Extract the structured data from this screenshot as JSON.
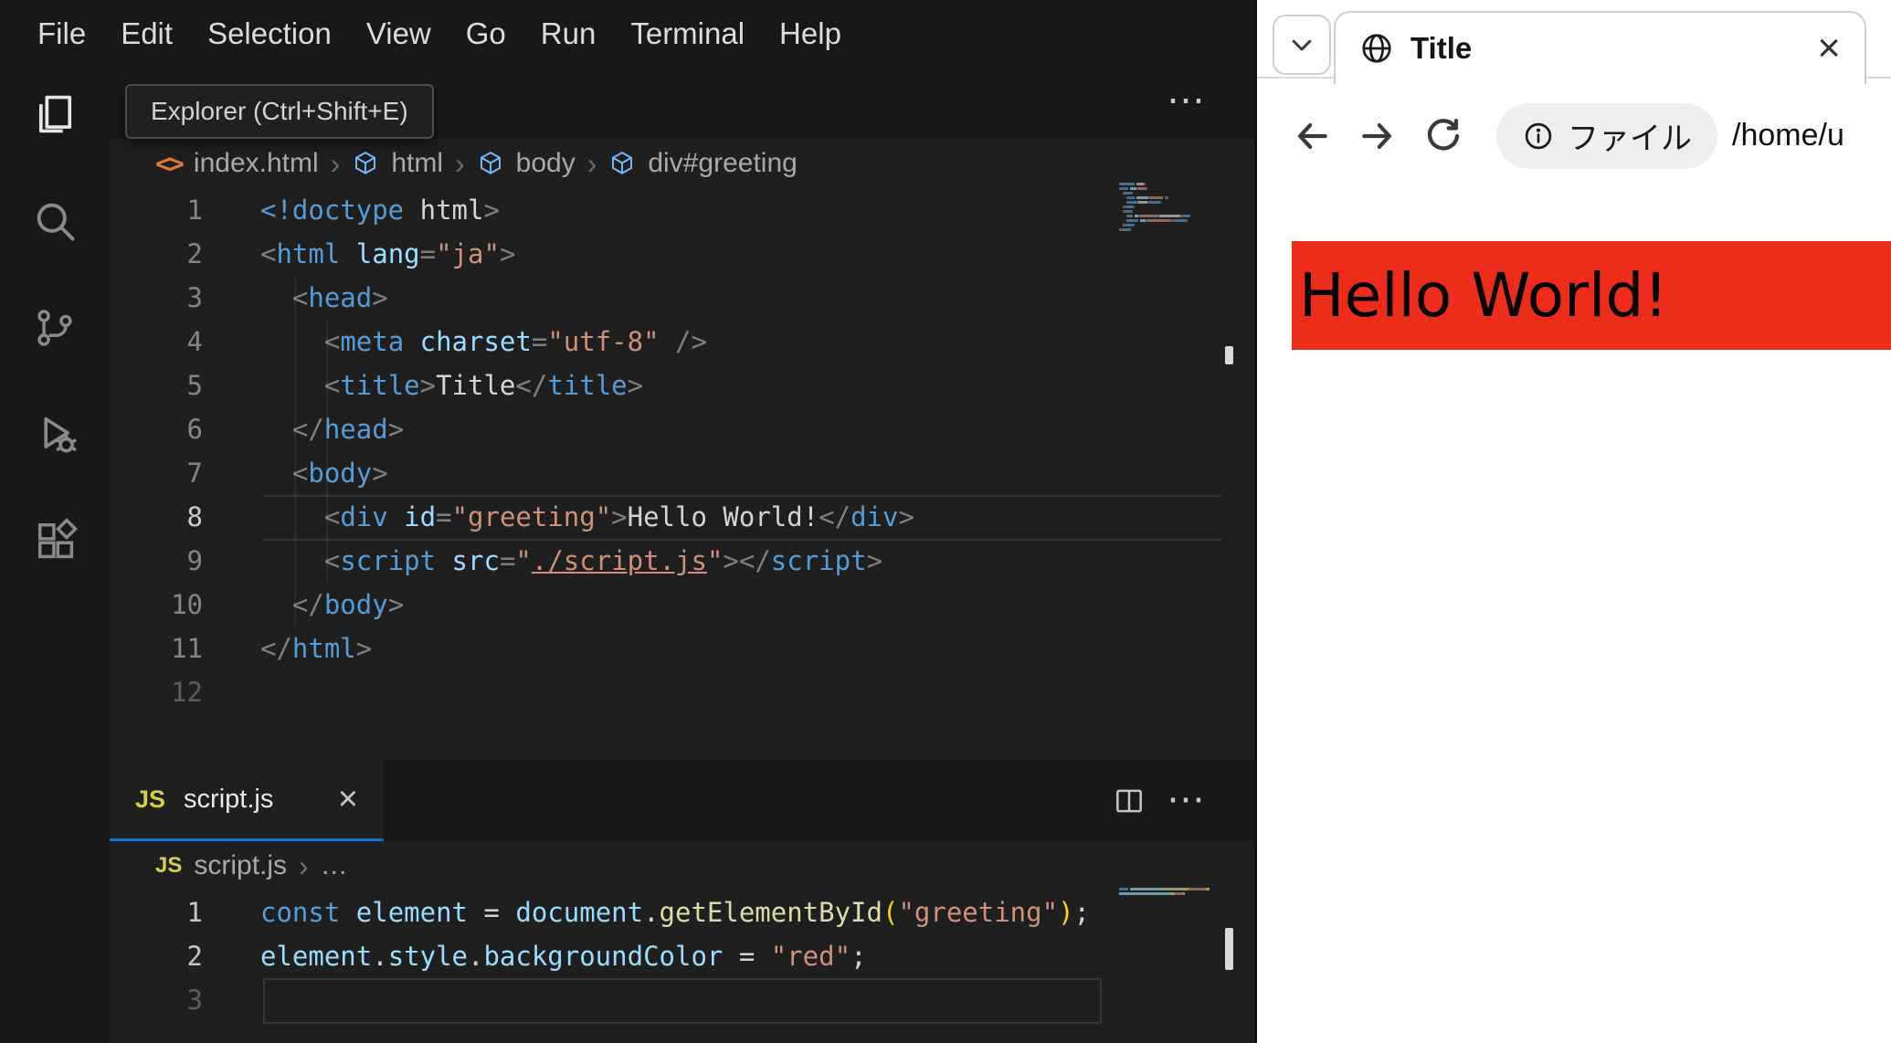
{
  "vscode": {
    "menubar": {
      "items": [
        "File",
        "Edit",
        "Selection",
        "View",
        "Go",
        "Run",
        "Terminal",
        "Help"
      ]
    },
    "activity_bar": {
      "items": [
        "explorer",
        "search",
        "source-control",
        "run-and-debug",
        "extensions"
      ]
    },
    "tooltip": {
      "text": "Explorer (Ctrl+Shift+E)"
    },
    "editor_actions": {
      "more": "⋯"
    },
    "top_editor": {
      "breadcrumb": {
        "file_icon": "<>",
        "file_label": "index.html",
        "separator": "›",
        "symbols": [
          "html",
          "body",
          "div#greeting"
        ]
      },
      "active_line": 8,
      "code_lines": [
        {
          "n": "1",
          "s": [
            [
              "<!doctype",
              "tag"
            ],
            [
              " ",
              "fg"
            ],
            [
              "html",
              "fg"
            ],
            [
              ">",
              "punc"
            ]
          ]
        },
        {
          "n": "2",
          "s": [
            [
              "<",
              "punc"
            ],
            [
              "html",
              "tag"
            ],
            [
              " ",
              "fg"
            ],
            [
              "lang",
              "attr"
            ],
            [
              "=",
              "punc"
            ],
            [
              "\"ja\"",
              "str"
            ],
            [
              ">",
              "punc"
            ]
          ]
        },
        {
          "n": "3",
          "s": [
            [
              "  ",
              "fg"
            ],
            [
              "<",
              "punc"
            ],
            [
              "head",
              "tag"
            ],
            [
              ">",
              "punc"
            ]
          ]
        },
        {
          "n": "4",
          "s": [
            [
              "    ",
              "fg"
            ],
            [
              "<",
              "punc"
            ],
            [
              "meta",
              "tag"
            ],
            [
              " ",
              "fg"
            ],
            [
              "charset",
              "attr"
            ],
            [
              "=",
              "punc"
            ],
            [
              "\"utf-8\"",
              "str"
            ],
            [
              " ",
              "fg"
            ],
            [
              "/>",
              "punc"
            ]
          ]
        },
        {
          "n": "5",
          "s": [
            [
              "    ",
              "fg"
            ],
            [
              "<",
              "punc"
            ],
            [
              "title",
              "tag"
            ],
            [
              ">",
              "punc"
            ],
            [
              "Title",
              "fg"
            ],
            [
              "</",
              "punc"
            ],
            [
              "title",
              "tag"
            ],
            [
              ">",
              "punc"
            ]
          ]
        },
        {
          "n": "6",
          "s": [
            [
              "  ",
              "fg"
            ],
            [
              "</",
              "punc"
            ],
            [
              "head",
              "tag"
            ],
            [
              ">",
              "punc"
            ]
          ]
        },
        {
          "n": "7",
          "s": [
            [
              "  ",
              "fg"
            ],
            [
              "<",
              "punc"
            ],
            [
              "body",
              "tag"
            ],
            [
              ">",
              "punc"
            ]
          ]
        },
        {
          "n": "8",
          "lnc": "lineno_active",
          "s": [
            [
              "    ",
              "fg"
            ],
            [
              "<",
              "punc"
            ],
            [
              "div",
              "tag"
            ],
            [
              " ",
              "fg"
            ],
            [
              "id",
              "attr"
            ],
            [
              "=",
              "punc"
            ],
            [
              "\"greeting\"",
              "str"
            ],
            [
              ">",
              "punc"
            ],
            [
              "Hello World!",
              "fg"
            ],
            [
              "</",
              "punc"
            ],
            [
              "div",
              "tag"
            ],
            [
              ">",
              "punc"
            ]
          ]
        },
        {
          "n": "9",
          "s": [
            [
              "    ",
              "fg"
            ],
            [
              "<",
              "punc"
            ],
            [
              "script",
              "tag"
            ],
            [
              " ",
              "fg"
            ],
            [
              "src",
              "attr"
            ],
            [
              "=",
              "punc"
            ],
            [
              "\"",
              "str"
            ],
            [
              "./script.js",
              "link"
            ],
            [
              "\"",
              "str"
            ],
            [
              ">",
              "punc"
            ],
            [
              "</",
              "punc"
            ],
            [
              "script",
              "tag"
            ],
            [
              ">",
              "punc"
            ]
          ]
        },
        {
          "n": "10",
          "s": [
            [
              "  ",
              "fg"
            ],
            [
              "</",
              "punc"
            ],
            [
              "body",
              "tag"
            ],
            [
              ">",
              "punc"
            ]
          ]
        },
        {
          "n": "11",
          "s": [
            [
              "</",
              "punc"
            ],
            [
              "html",
              "tag"
            ],
            [
              ">",
              "punc"
            ]
          ]
        },
        {
          "n": "12",
          "lnc": "lineno_dim",
          "s": []
        }
      ]
    },
    "panel": {
      "tab": {
        "icon_text": "JS",
        "label": "script.js",
        "close_label": "×"
      },
      "breadcrumb": {
        "icon_text": "JS",
        "file_label": "script.js",
        "separator": "›",
        "more": "…"
      },
      "active_line": 3,
      "code_lines": [
        {
          "n": "1",
          "lnc": "lineno_bright",
          "s": [
            [
              "const",
              "kw"
            ],
            [
              " ",
              "fg"
            ],
            [
              "element",
              "attr"
            ],
            [
              " = ",
              "fg"
            ],
            [
              "document",
              "attr"
            ],
            [
              ".",
              "fg"
            ],
            [
              "getElementById",
              "func"
            ],
            [
              "(",
              "bracket"
            ],
            [
              "\"greeting\"",
              "str"
            ],
            [
              ")",
              "bracket"
            ],
            [
              ";",
              "fg"
            ]
          ]
        },
        {
          "n": "2",
          "lnc": "lineno_bright",
          "s": [
            [
              "element",
              "attr"
            ],
            [
              ".",
              "fg"
            ],
            [
              "style",
              "attr"
            ],
            [
              ".",
              "fg"
            ],
            [
              "backgroundColor",
              "attr"
            ],
            [
              " = ",
              "fg"
            ],
            [
              "\"red\"",
              "str"
            ],
            [
              ";",
              "fg"
            ]
          ]
        },
        {
          "n": "3",
          "lnc": "lineno_dim",
          "s": []
        }
      ]
    },
    "syntax_colors": {
      "fg": "#d4d4d4",
      "tag": "#569cd6",
      "attr": "#9cdcfe",
      "str": "#ce9178",
      "punc": "#808080",
      "kw": "#569cd6",
      "func": "#dcdcaa",
      "bracket": "#ffd700",
      "link": "#ce9178",
      "lineno": "#858585",
      "lineno_active": "#cccccc",
      "lineno_bright": "#c6c6c6",
      "lineno_dim": "#5c5c5c",
      "accent": "#0078d4",
      "js_icon": "#d7cf42",
      "html_icon": "#e37933",
      "symbol_icon": "#75beff"
    }
  },
  "browser": {
    "tab": {
      "title": "Title",
      "close_label": "×"
    },
    "toolbar": {
      "chip_label": "ファイル",
      "url_text": "/home/u"
    },
    "page": {
      "heading": "Hello World!",
      "heading_bg": "#ee2c1c",
      "heading_color": "#000000"
    }
  }
}
